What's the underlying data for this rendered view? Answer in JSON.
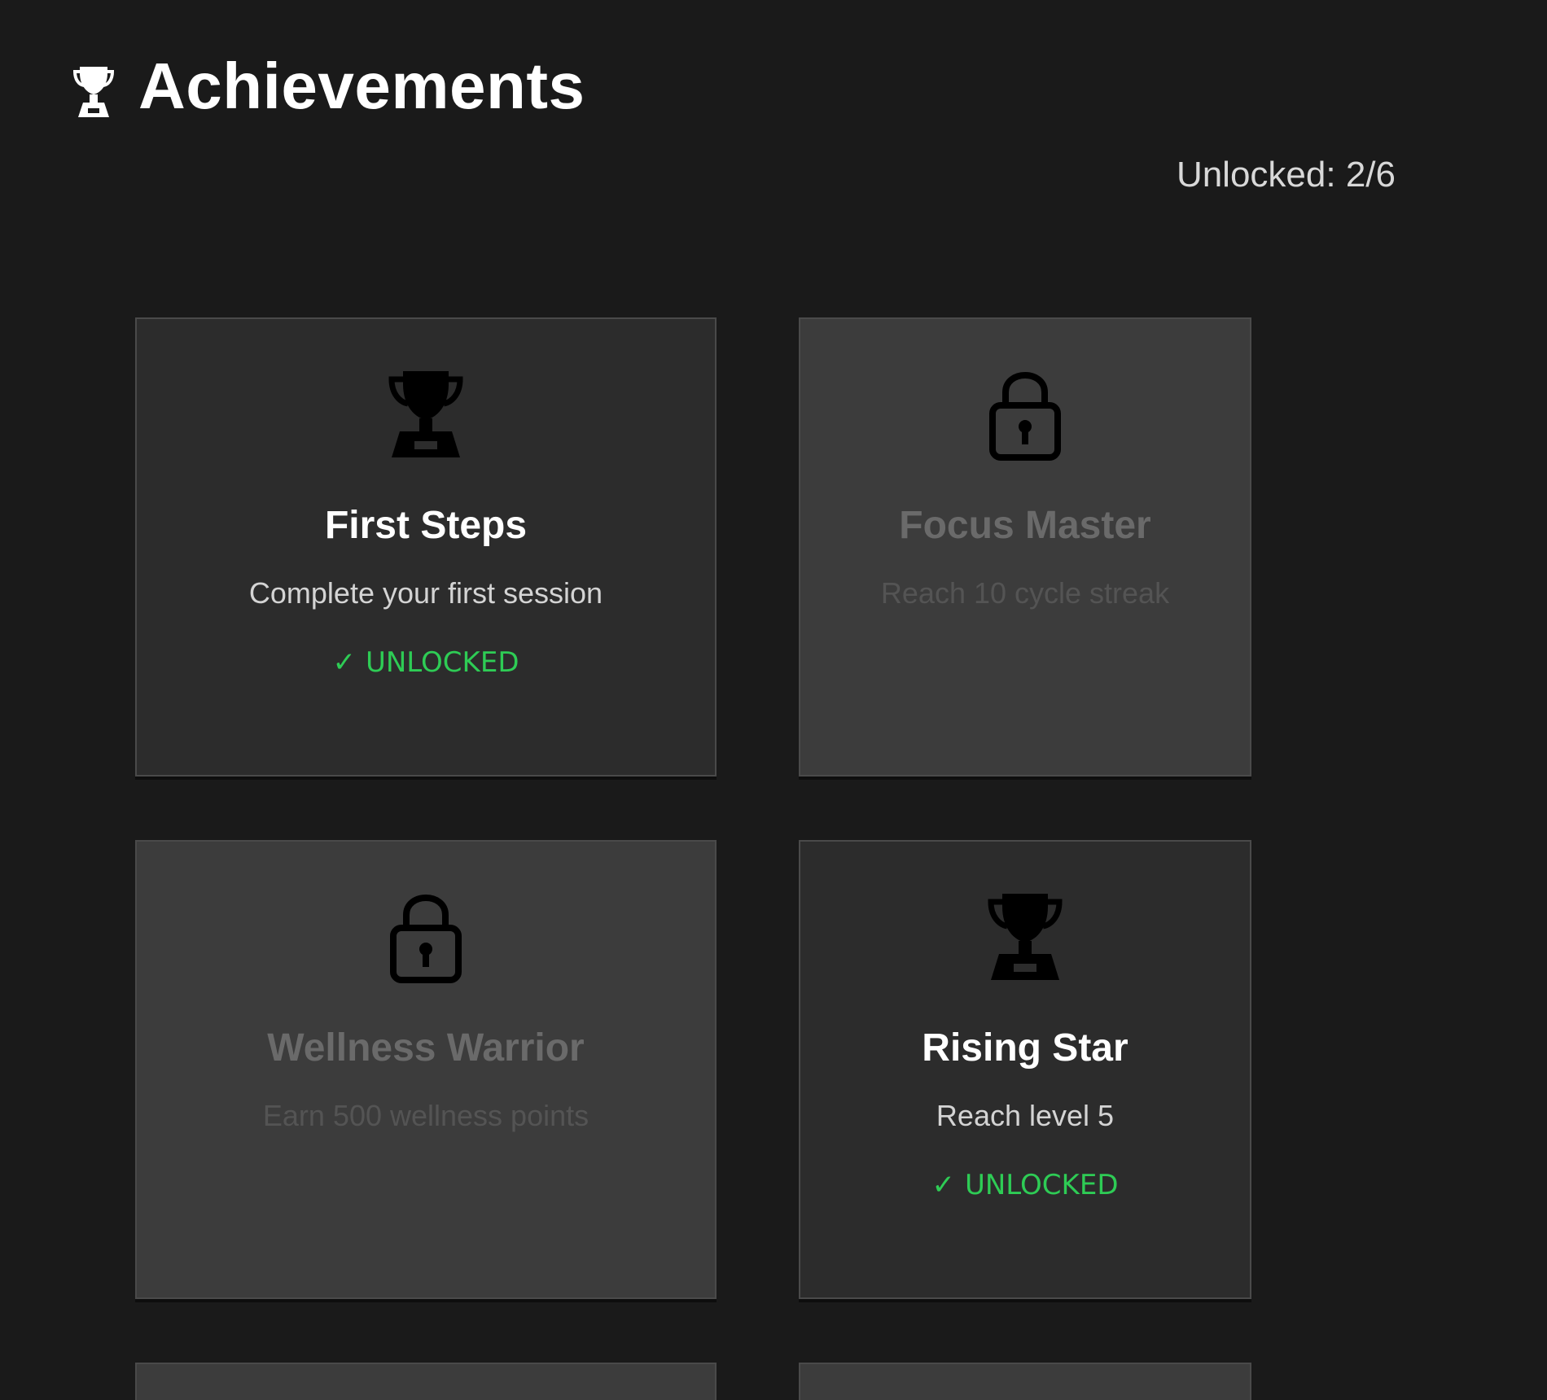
{
  "header": {
    "icon": "trophy-icon",
    "title": "Achievements"
  },
  "summary": {
    "unlocked_text": "Unlocked: 2/6"
  },
  "colors": {
    "background": "#1a1a1a",
    "card_unlocked": "#2c2c2c",
    "card_locked": "#3c3c3c",
    "status_green": "#2ecc55"
  },
  "achievements": [
    {
      "title": "First Steps",
      "description": "Complete your first session",
      "unlocked": true,
      "icon": "trophy-icon",
      "status_label": "UNLOCKED",
      "status_icon": "✓"
    },
    {
      "title": "Focus Master",
      "description": "Reach 10 cycle streak",
      "unlocked": false,
      "icon": "lock-icon"
    },
    {
      "title": "Wellness Warrior",
      "description": "Earn 500 wellness points",
      "unlocked": false,
      "icon": "lock-icon"
    },
    {
      "title": "Rising Star",
      "description": "Reach level 5",
      "unlocked": true,
      "icon": "trophy-icon",
      "status_label": "UNLOCKED",
      "status_icon": "✓"
    }
  ]
}
